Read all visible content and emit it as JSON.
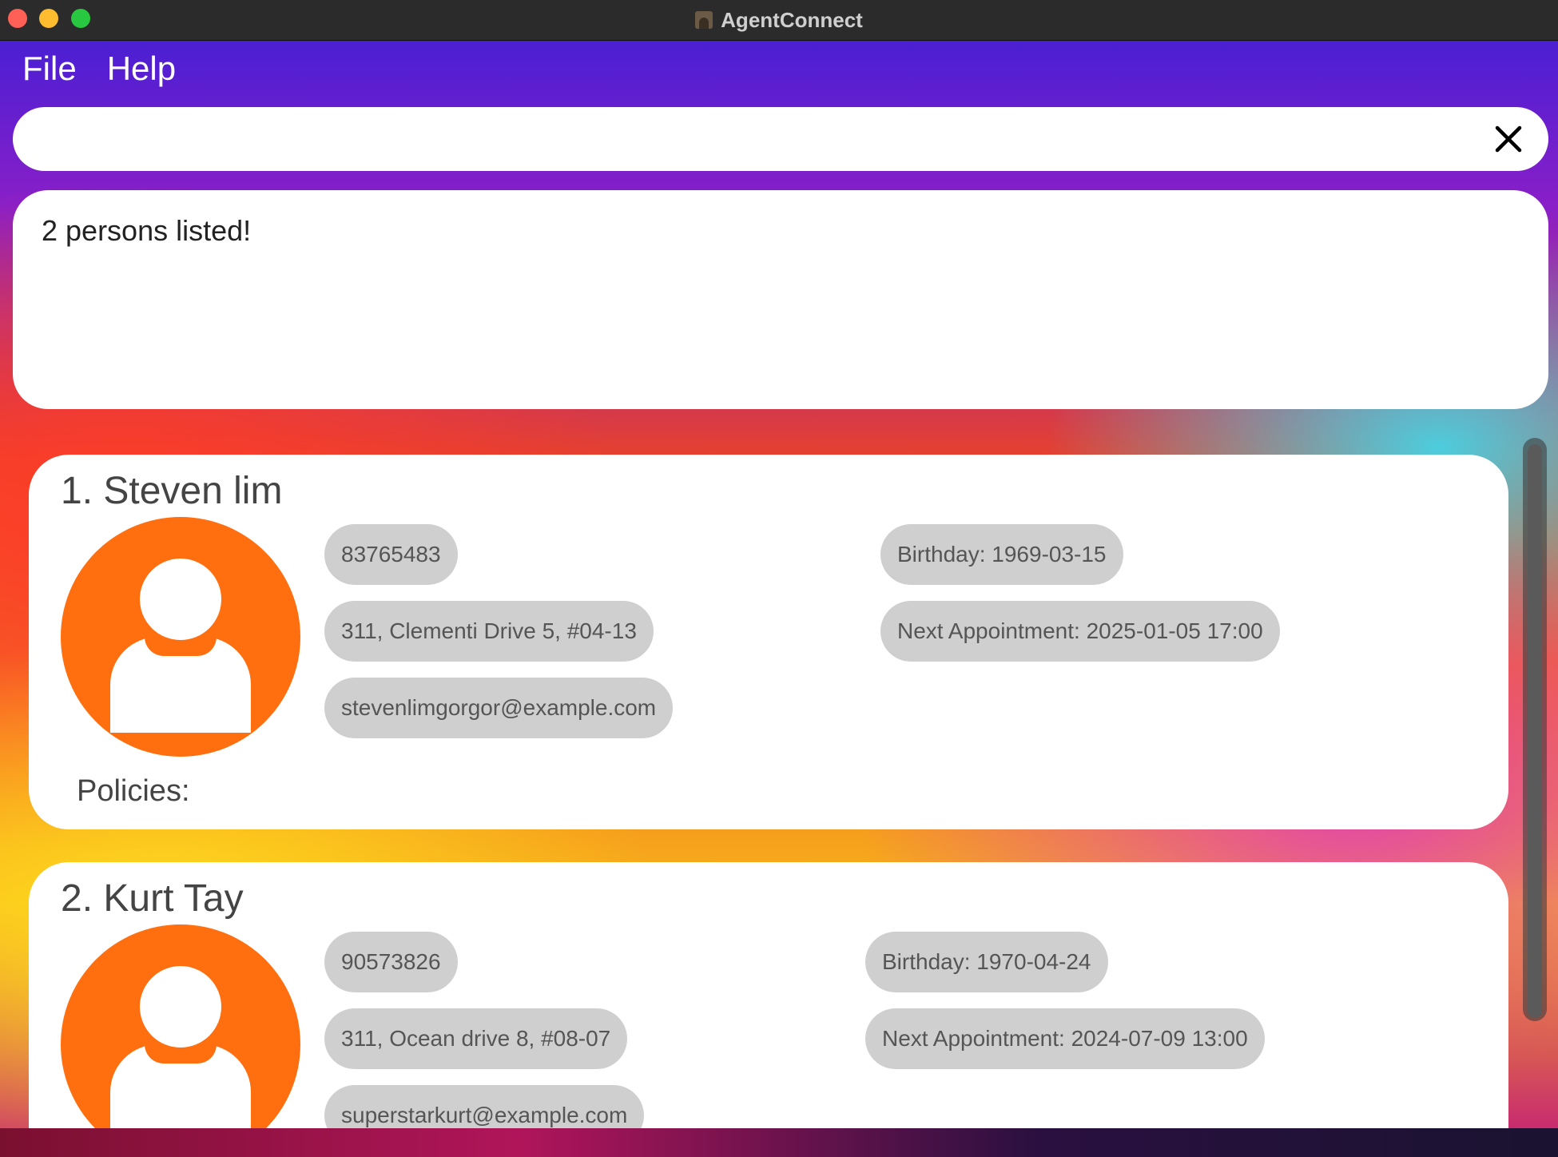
{
  "window": {
    "title": "AgentConnect"
  },
  "menu": {
    "file": "File",
    "help": "Help"
  },
  "command": {
    "value": "",
    "placeholder": ""
  },
  "result": {
    "message": "2 persons listed!"
  },
  "persons": [
    {
      "name": "1. Steven lim",
      "phone": "83765483",
      "address": "311, Clementi Drive 5, #04-13",
      "email": "stevenlimgorgor@example.com",
      "birthday": "Birthday: 1969-03-15",
      "appointment": "Next Appointment: 2025-01-05 17:00",
      "policies_label": "Policies:"
    },
    {
      "name": "2. Kurt Tay",
      "phone": "90573826",
      "address": "311, Ocean drive 8, #08-07",
      "email": "superstarkurt@example.com",
      "birthday": "Birthday: 1970-04-24",
      "appointment": "Next Appointment: 2024-07-09 13:00"
    }
  ],
  "colors": {
    "avatar": "#ff6f0f",
    "chip": "#cfcfcf"
  },
  "icons": [
    "app-icon",
    "close-icon",
    "person-avatar-icon"
  ]
}
